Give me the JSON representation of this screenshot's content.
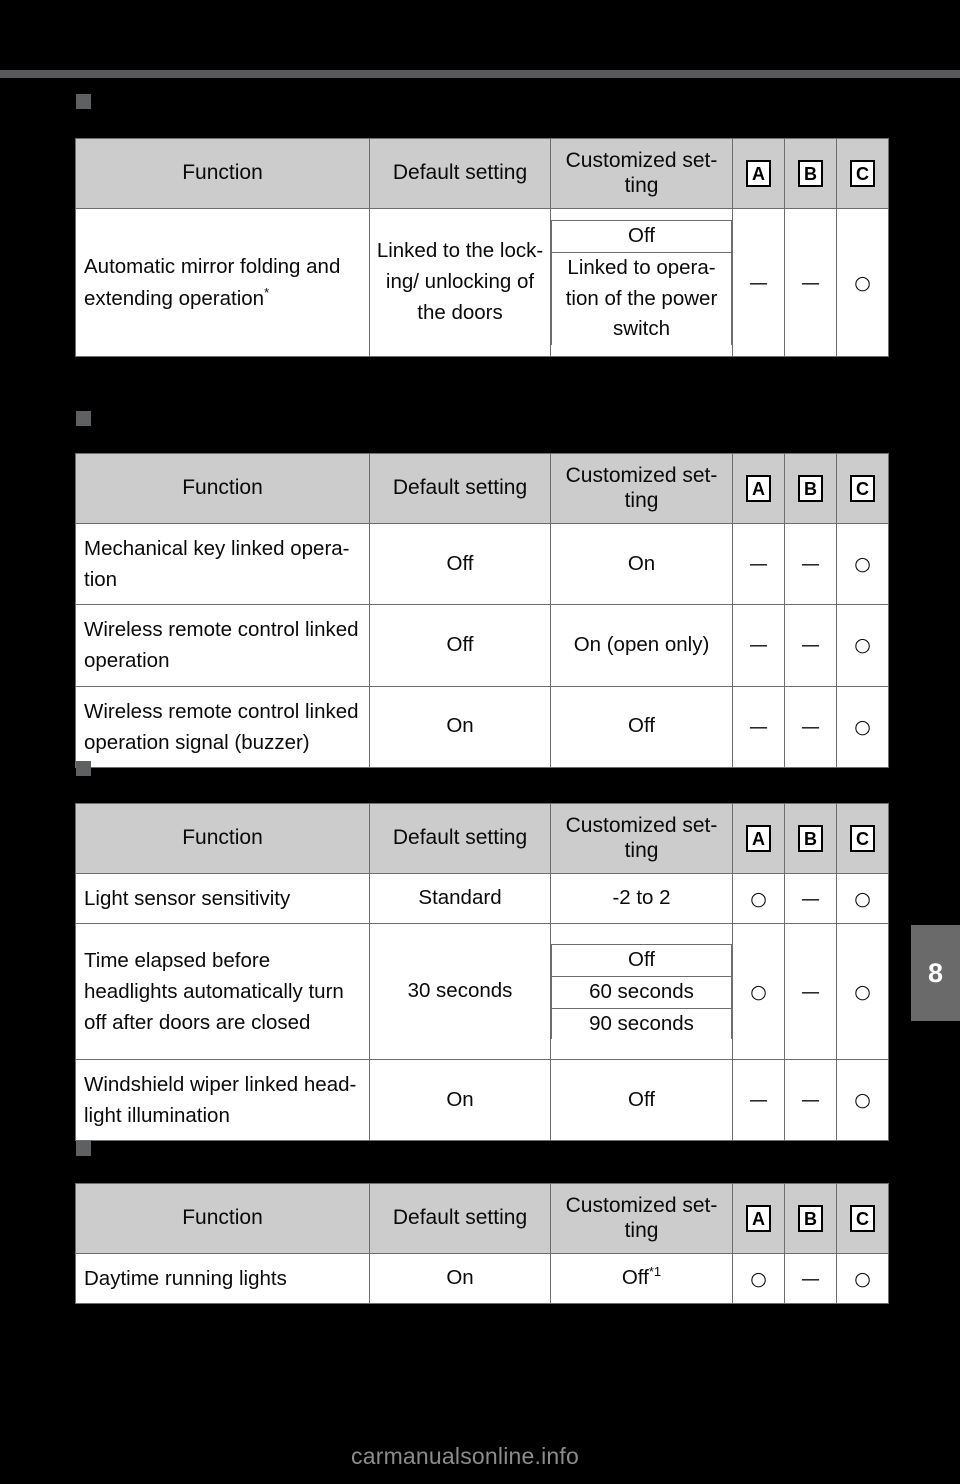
{
  "page": {
    "chapter_tab": "8",
    "watermark": "carmanualsonline.info"
  },
  "columns": {
    "function": "Function",
    "default_setting": "Default setting",
    "customized_setting": "Customized set-\nting",
    "a": "A",
    "b": "B",
    "c": "C"
  },
  "marks": {
    "yes": "○",
    "no": "—"
  },
  "tables": [
    {
      "id": "mirror-table",
      "rows": [
        {
          "function": "Automatic mirror folding and extending operation",
          "function_footnote": "*",
          "default": "Linked to the lock- ing/ unlocking of the doors",
          "customized": [
            "Off",
            "Linked to opera- tion of the power switch"
          ],
          "a": "—",
          "b": "—",
          "c": "○"
        }
      ]
    },
    {
      "id": "window-table",
      "rows": [
        {
          "function": "Mechanical key linked opera- tion",
          "function_footnote": "",
          "default": "Off",
          "customized": [
            "On"
          ],
          "a": "—",
          "b": "—",
          "c": "○"
        },
        {
          "function": "Wireless remote control linked operation",
          "function_footnote": "",
          "default": "Off",
          "customized": [
            "On (open only)"
          ],
          "a": "—",
          "b": "—",
          "c": "○"
        },
        {
          "function": "Wireless remote control linked operation signal (buzzer)",
          "function_footnote": "",
          "default": "On",
          "customized": [
            "Off"
          ],
          "a": "—",
          "b": "—",
          "c": "○"
        }
      ]
    },
    {
      "id": "headlight-table",
      "rows": [
        {
          "function": "Light sensor sensitivity",
          "function_footnote": "",
          "default": "Standard",
          "customized": [
            "-2 to 2"
          ],
          "a": "○",
          "b": "—",
          "c": "○"
        },
        {
          "function": "Time elapsed before headlights automatically turn off after doors are closed",
          "function_footnote": "",
          "default": "30 seconds",
          "customized": [
            "Off",
            "60 seconds",
            "90 seconds"
          ],
          "a": "○",
          "b": "—",
          "c": "○"
        },
        {
          "function": "Windshield wiper linked head- light illumination",
          "function_footnote": "",
          "default": "On",
          "customized": [
            "Off"
          ],
          "a": "—",
          "b": "—",
          "c": "○"
        }
      ]
    },
    {
      "id": "drl-table",
      "rows": [
        {
          "function": "Daytime running lights",
          "function_footnote": "",
          "default": "On",
          "customized": [
            "Off"
          ],
          "customized_footnote": "*1",
          "a": "○",
          "b": "—",
          "c": "○"
        }
      ]
    }
  ]
}
